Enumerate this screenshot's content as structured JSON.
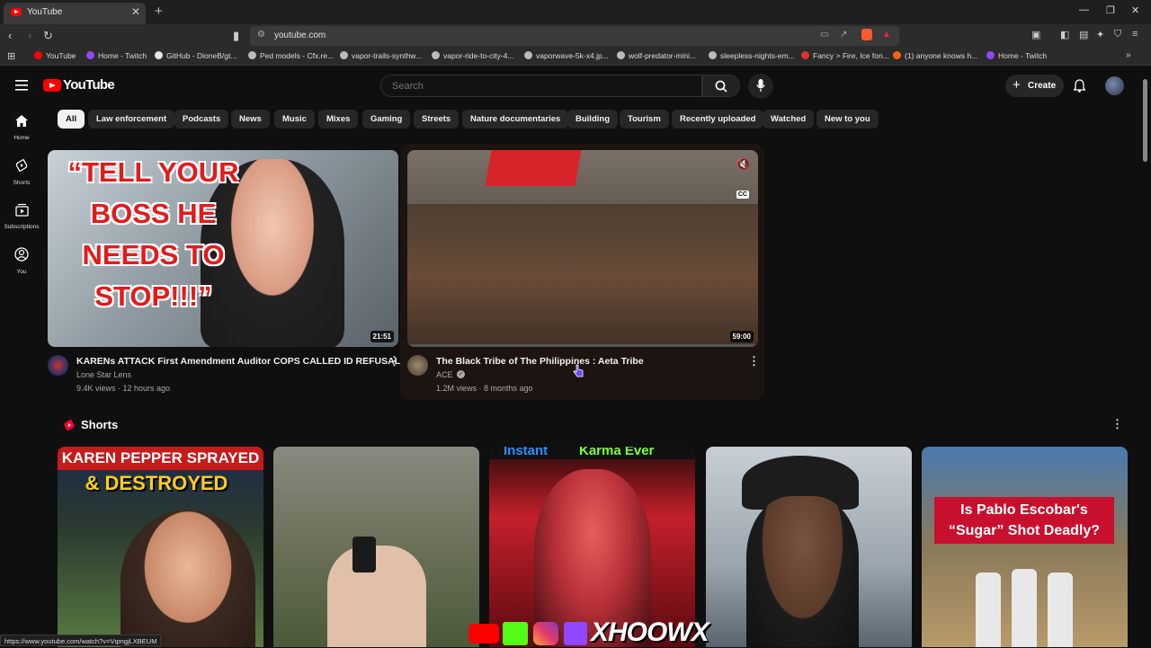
{
  "browser": {
    "tab_title": "YouTube",
    "url": "youtube.com",
    "status_url": "https://www.youtube.com/watch?v=VqmgjLXBEUM",
    "bookmarks": [
      {
        "label": "YouTube",
        "color": "#ff0000"
      },
      {
        "label": "Home - Twitch",
        "color": "#9146ff"
      },
      {
        "label": "GitHub - DioneB/gt...",
        "color": "#e6e6e6"
      },
      {
        "label": "Ped models - Cfx.re...",
        "color": "#bbbbbb"
      },
      {
        "label": "vapor-trails-synthw...",
        "color": "#bbbbbb"
      },
      {
        "label": "vapor-ride-to-city-4...",
        "color": "#bbbbbb"
      },
      {
        "label": "vaporwave-5k-x4.jp...",
        "color": "#bbbbbb"
      },
      {
        "label": "wolf-predator-mini...",
        "color": "#bbbbbb"
      },
      {
        "label": "sleepless-nights-em...",
        "color": "#bbbbbb"
      },
      {
        "label": "Fancy > Fire, Ice fon...",
        "color": "#e03030"
      },
      {
        "label": "(1) anyone knows h...",
        "color": "#ff6314"
      },
      {
        "label": "Home - Twitch",
        "color": "#9146ff"
      }
    ]
  },
  "header": {
    "logo_text": "YouTube",
    "search_placeholder": "Search",
    "create_label": "Create"
  },
  "sidebar": [
    {
      "label": "Home",
      "icon": "home-icon"
    },
    {
      "label": "Shorts",
      "icon": "shorts-icon"
    },
    {
      "label": "Subscriptions",
      "icon": "subscriptions-icon"
    },
    {
      "label": "You",
      "icon": "you-icon"
    }
  ],
  "chips": [
    "All",
    "Law enforcement",
    "Podcasts",
    "News",
    "Music",
    "Mixes",
    "Gaming",
    "Streets",
    "Nature documentaries",
    "Building",
    "Tourism",
    "Recently uploaded",
    "Watched",
    "New to you"
  ],
  "videos": [
    {
      "title": "KARENs ATTACK First Amendment Auditor COPS CALLED ID REFUSAL",
      "channel": "Lone Star Lens",
      "meta": "9.4K views · 12 hours ago",
      "duration": "21:51",
      "thumb_text": "“TELL YOUR BOSS HE NEEDS TO STOP!!!”"
    },
    {
      "title": "The Black Tribe of The Philippines : Aeta Tribe",
      "channel": "ACE",
      "meta": "1.2M views · 8 months ago",
      "duration": "59:00",
      "cc": "CC"
    }
  ],
  "shorts": {
    "section_title": "Shorts",
    "items": [
      {
        "line1": "KAREN PEPPER SPRAYED",
        "line2": "& DESTROYED"
      },
      {
        "line1": "",
        "line2": ""
      },
      {
        "line1": "Instant",
        "line2": "Karma Ever"
      },
      {
        "line1": "",
        "line2": ""
      },
      {
        "line1": "Is Pablo Escobar's",
        "line2": "“Sugar” Shot Deadly?"
      }
    ],
    "watermark": "XHOOWX"
  }
}
